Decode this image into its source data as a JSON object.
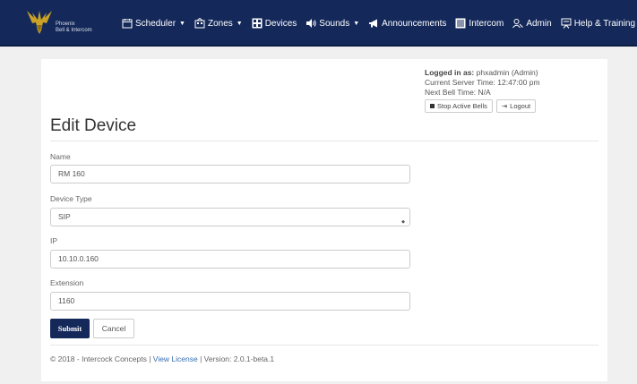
{
  "brand": {
    "line1": "Phoenix",
    "line2": "Bell & Intercom",
    "logo": "eagle-logo"
  },
  "nav": {
    "scheduler": "Scheduler",
    "zones": "Zones",
    "devices": "Devices",
    "sounds": "Sounds",
    "announcements": "Announcements",
    "intercom": "Intercom",
    "admin": "Admin",
    "help": "Help & Training"
  },
  "status": {
    "logged_in_label": "Logged in as:",
    "logged_in_value": "phxadmin (Admin)",
    "server_time_label": "Current Server Time:",
    "server_time_value": "12:47:00 pm",
    "next_bell_label": "Next Bell Time:",
    "next_bell_value": "N/A",
    "stop_bells": "Stop Active Bells",
    "logout": "Logout"
  },
  "page": {
    "title": "Edit Device"
  },
  "form": {
    "name_label": "Name",
    "name_value": "RM 160",
    "type_label": "Device Type",
    "type_value": "SIP",
    "ip_label": "IP",
    "ip_value": "10.10.0.160",
    "ext_label": "Extension",
    "ext_value": "1160",
    "submit": "Submit",
    "cancel": "Cancel"
  },
  "footer": {
    "copyright": "© 2018 - Intercock Concepts |",
    "license": "View License",
    "version": "| Version: 2.0.1-beta.1"
  },
  "colors": {
    "navbar": "#14295a",
    "submit": "#14295a",
    "link": "#3a6fb0"
  }
}
